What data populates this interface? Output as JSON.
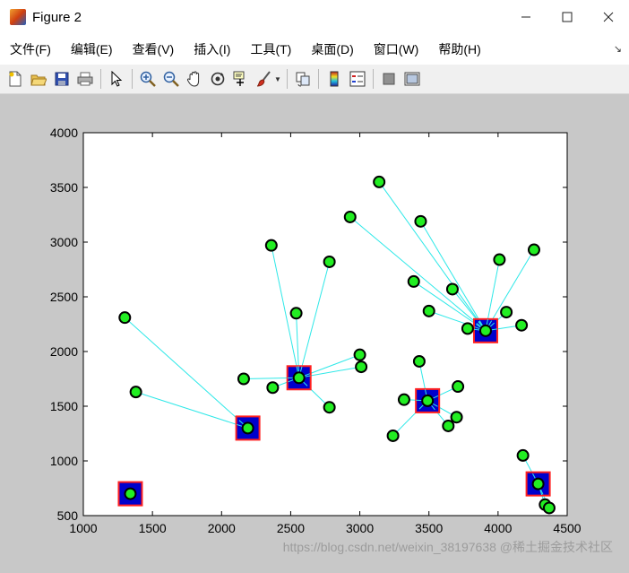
{
  "window": {
    "title": "Figure 2",
    "controls": [
      "minimize",
      "maximize",
      "close"
    ]
  },
  "menu": {
    "items": [
      "文件(F)",
      "编辑(E)",
      "查看(V)",
      "插入(I)",
      "工具(T)",
      "桌面(D)",
      "窗口(W)",
      "帮助(H)"
    ]
  },
  "toolbar": {
    "icons": [
      "new-figure-icon",
      "open-file-icon",
      "save-icon",
      "print-icon",
      "pointer-icon",
      "zoom-in-icon",
      "zoom-out-icon",
      "pan-icon",
      "rotate-3d-icon",
      "data-cursor-icon",
      "brush-icon",
      "link-plot-icon",
      "colorbar-icon",
      "legend-icon",
      "hide-plot-tools-icon",
      "show-plot-tools-icon"
    ]
  },
  "colors": {
    "point_fill": "#22ee22",
    "point_edge": "#000000",
    "center_fill": "#0000cc",
    "center_edge": "#ff2020",
    "line": "#2ee8e8",
    "axes_bg": "#ffffff",
    "figure_bg": "#c8c8c8"
  },
  "watermark": "https://blog.csdn.net/weixin_38197638 @稀土掘金技术社区",
  "chart_data": {
    "type": "scatter",
    "title": "",
    "xlabel": "",
    "ylabel": "",
    "xlim": [
      1000,
      4500
    ],
    "ylim": [
      500,
      4000
    ],
    "xticks": [
      1000,
      1500,
      2000,
      2500,
      3000,
      3500,
      4000,
      4500
    ],
    "yticks": [
      500,
      1000,
      1500,
      2000,
      2500,
      3000,
      3500,
      4000
    ],
    "grid": false,
    "clusters": [
      {
        "center": [
          1340,
          700
        ],
        "points": [
          [
            1340,
            700
          ]
        ]
      },
      {
        "center": [
          2190,
          1300
        ],
        "points": [
          [
            1300,
            2310
          ],
          [
            1380,
            1630
          ],
          [
            2190,
            1300
          ]
        ]
      },
      {
        "center": [
          2560,
          1760
        ],
        "points": [
          [
            2160,
            1750
          ],
          [
            2370,
            1670
          ],
          [
            2360,
            2970
          ],
          [
            2540,
            2350
          ],
          [
            2780,
            2820
          ],
          [
            2780,
            1490
          ],
          [
            3000,
            1970
          ],
          [
            3010,
            1860
          ],
          [
            2560,
            1760
          ]
        ]
      },
      {
        "center": [
          3490,
          1550
        ],
        "points": [
          [
            3430,
            1910
          ],
          [
            3320,
            1560
          ],
          [
            3240,
            1230
          ],
          [
            3640,
            1320
          ],
          [
            3700,
            1400
          ],
          [
            3710,
            1680
          ],
          [
            3490,
            1550
          ]
        ]
      },
      {
        "center": [
          3910,
          2190
        ],
        "points": [
          [
            2930,
            3230
          ],
          [
            3140,
            3550
          ],
          [
            3440,
            3190
          ],
          [
            3390,
            2640
          ],
          [
            3500,
            2370
          ],
          [
            3670,
            2570
          ],
          [
            3780,
            2210
          ],
          [
            4010,
            2840
          ],
          [
            4060,
            2360
          ],
          [
            4170,
            2240
          ],
          [
            4260,
            2930
          ],
          [
            3910,
            2190
          ]
        ]
      },
      {
        "center": [
          4290,
          790
        ],
        "points": [
          [
            4180,
            1050
          ],
          [
            4340,
            600
          ],
          [
            4370,
            570
          ],
          [
            4290,
            790
          ]
        ]
      }
    ]
  }
}
